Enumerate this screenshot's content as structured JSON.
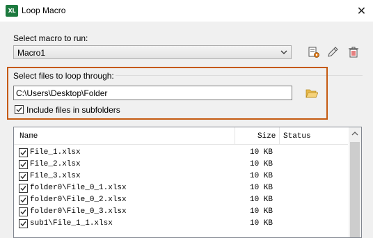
{
  "window": {
    "title": "Loop Macro",
    "app_icon_text": "XL",
    "close_glyph": "✕"
  },
  "macro": {
    "label": "Select macro to run:",
    "selected": "Macro1"
  },
  "toolbar": {
    "icons": [
      "run-settings-icon",
      "edit-pencil-icon",
      "delete-trash-icon"
    ]
  },
  "files": {
    "group_label": "Select files to loop through:",
    "folder_path": "C:\\Users\\Desktop\\Folder",
    "include_subfolders_label": "Include files in subfolders",
    "include_subfolders_checked": true
  },
  "list": {
    "headers": {
      "name": "Name",
      "size": "Size",
      "status": "Status"
    },
    "rows": [
      {
        "name": "File_1.xlsx",
        "size": "10 KB",
        "status": "",
        "checked": true
      },
      {
        "name": "File_2.xlsx",
        "size": "10 KB",
        "status": "",
        "checked": true
      },
      {
        "name": "File_3.xlsx",
        "size": "10 KB",
        "status": "",
        "checked": true
      },
      {
        "name": "folder0\\File_0_1.xlsx",
        "size": "10 KB",
        "status": "",
        "checked": true
      },
      {
        "name": "folder0\\File_0_2.xlsx",
        "size": "10 KB",
        "status": "",
        "checked": true
      },
      {
        "name": "folder0\\File_0_3.xlsx",
        "size": "10 KB",
        "status": "",
        "checked": true
      },
      {
        "name": "sub1\\File_1_1.xlsx",
        "size": "10 KB",
        "status": "",
        "checked": true
      }
    ]
  },
  "colors": {
    "highlight_border": "#c55a11",
    "app_icon_bg": "#1d7a3f"
  }
}
